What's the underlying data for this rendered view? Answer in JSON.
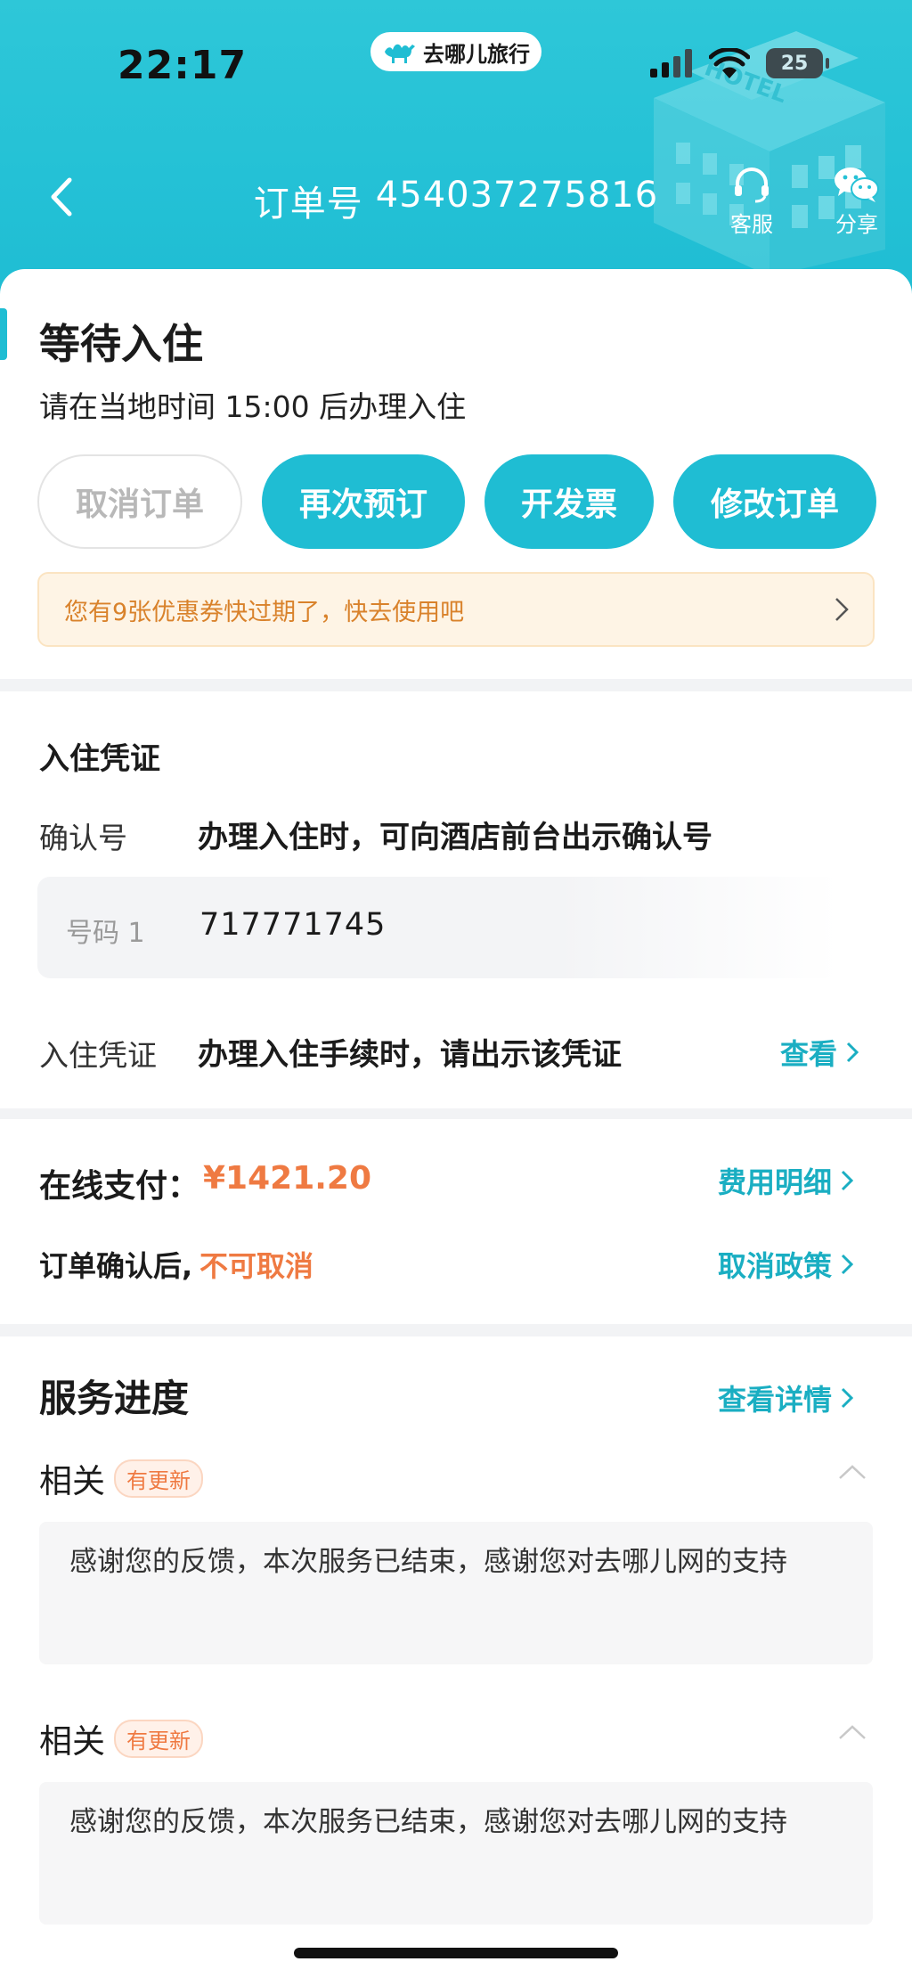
{
  "status_bar": {
    "time": "22:17",
    "app_name": "去哪儿旅行",
    "battery": "25"
  },
  "nav": {
    "order_label": "订单号",
    "order_number": "454037275816",
    "service_label": "客服",
    "share_label": "分享",
    "back_icon": "chevron-left-icon"
  },
  "status": {
    "title": "等待入住",
    "subtitle": "请在当地时间 15:00 后办理入住"
  },
  "actions": {
    "cancel": "取消订单",
    "rebook": "再次预订",
    "invoice": "开发票",
    "modify": "修改订单"
  },
  "coupon": {
    "text": "您有9张优惠券快过期了，快去使用吧"
  },
  "checkin": {
    "section_title": "入住凭证",
    "confirm_label": "确认号",
    "confirm_desc": "办理入住时，可向酒店前台出示确认号",
    "code_label": "号码 1",
    "code_value": "717771745",
    "voucher_label": "入住凭证",
    "voucher_desc": "办理入住手续时，请出示该凭证",
    "view_link": "查看"
  },
  "payment": {
    "label": "在线支付：",
    "amount": "¥1421.20",
    "detail_link": "费用明细",
    "cancel_prefix": "订单确认后,",
    "cancel_value": "不可取消",
    "policy_link": "取消政策"
  },
  "service": {
    "title": "服务进度",
    "detail_link": "查看详情",
    "items": [
      {
        "label": "相关",
        "badge": "有更新",
        "message": "感谢您的反馈，本次服务已结束，感谢您对去哪儿网的支持"
      },
      {
        "label": "相关",
        "badge": "有更新",
        "message": "感谢您的反馈，本次服务已结束，感谢您对去哪儿网的支持"
      }
    ]
  },
  "colors": {
    "brand": "#1fbdd3",
    "accent_orange": "#ef7a42",
    "coupon_text": "#d9822b",
    "link": "#1aaec2"
  }
}
